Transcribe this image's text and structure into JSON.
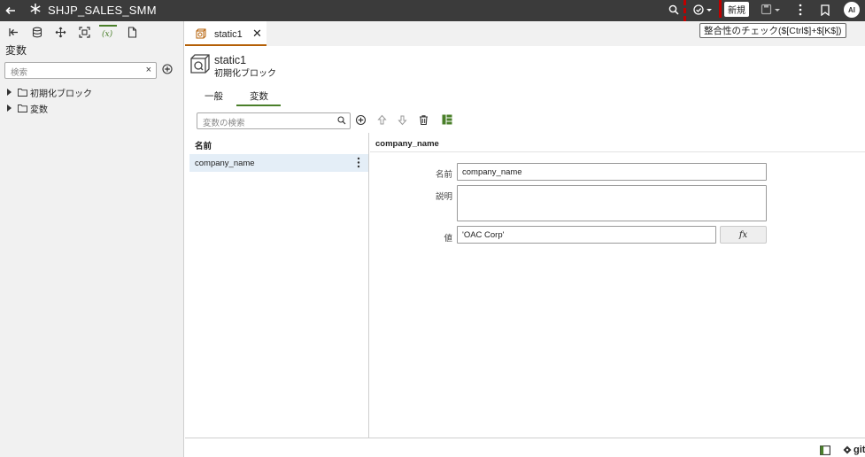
{
  "app": {
    "title": "SHJP_SALES_SMM",
    "new_label": "新規",
    "avatar_initials": "AI",
    "tooltip": "整合性のチェック($[Ctrl$]+$[K$])"
  },
  "left_panel": {
    "heading": "変数",
    "search_placeholder": "検索",
    "clear_symbol": "×",
    "tree": [
      {
        "label": "初期化ブロック"
      },
      {
        "label": "変数"
      }
    ]
  },
  "doc_tab": {
    "label": "static1",
    "close_symbol": "✕"
  },
  "header": {
    "title": "static1",
    "subtitle": "初期化ブロック"
  },
  "subtabs": [
    {
      "label": "一般",
      "active": false
    },
    {
      "label": "変数",
      "active": true
    }
  ],
  "var_toolbar": {
    "search_placeholder": "変数の検索"
  },
  "list": {
    "header": "名前",
    "rows": [
      {
        "name": "company_name",
        "selected": true
      }
    ]
  },
  "detail": {
    "heading": "company_name",
    "name_label": "名前",
    "name_value": "company_name",
    "desc_label": "説明",
    "desc_value": "",
    "value_label": "値",
    "value_value": "'OAC Corp'",
    "fx_label": "fx"
  },
  "bottom": {
    "git_label": "git"
  },
  "colors": {
    "topbar": "#3b3b3b",
    "accent_green": "#4a7f2a",
    "tab_accent": "#b45f06",
    "selection": "#e4eef7",
    "focus_mark": "#c00000"
  }
}
